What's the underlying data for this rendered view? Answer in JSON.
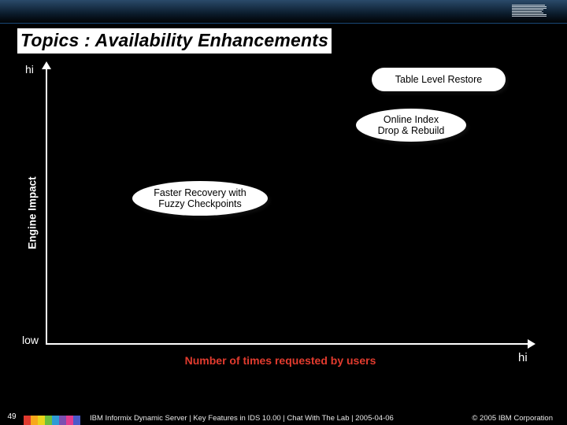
{
  "header": {
    "logo_name": "ibm-logo"
  },
  "title": "Topics : Availability Enhancements",
  "chart_data": {
    "type": "scatter",
    "xlabel": "Number of times requested by users",
    "ylabel": "Engine Impact",
    "x_low": "low",
    "x_high": "hi",
    "y_low": "low",
    "y_high": "hi",
    "points": [
      {
        "label": "Table Level Restore",
        "x": "hi",
        "y": "hi"
      },
      {
        "label": "Online Index\nDrop & Rebuild",
        "x": "hi",
        "y": "hi-mid"
      },
      {
        "label": "Faster Recovery with\nFuzzy Checkpoints",
        "x": "low-mid",
        "y": "mid"
      }
    ]
  },
  "bubbles": {
    "table": "Table Level Restore",
    "index_l1": "Online Index",
    "index_l2": "Drop & Rebuild",
    "faster_l1": "Faster Recovery with",
    "faster_l2": "Fuzzy Checkpoints"
  },
  "footer": {
    "page": "49",
    "left": "IBM Informix Dynamic Server  |  Key Features in IDS 10.00  |  Chat With The Lab  |  2005-04-06",
    "right": "© 2005 IBM Corporation"
  }
}
